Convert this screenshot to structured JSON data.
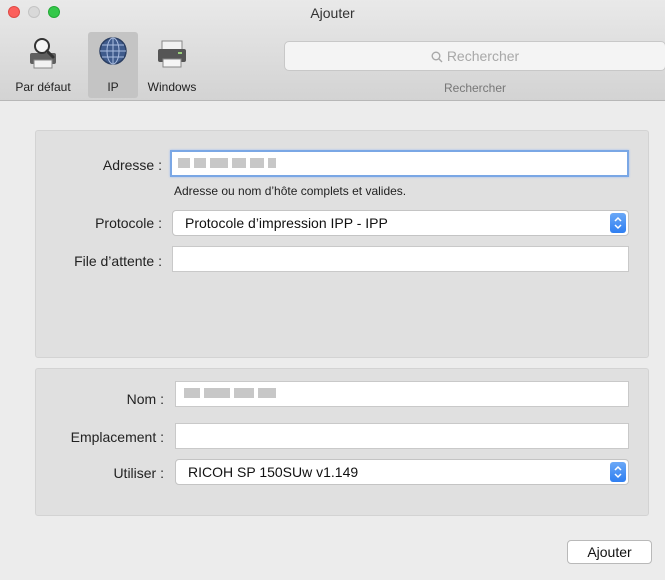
{
  "window": {
    "title": "Ajouter"
  },
  "toolbar": {
    "items": [
      {
        "label": "Par défaut",
        "icon": "default-printer-icon"
      },
      {
        "label": "IP",
        "icon": "globe-icon",
        "selected": true
      },
      {
        "label": "Windows",
        "icon": "windows-printer-icon"
      }
    ]
  },
  "search": {
    "placeholder": "Rechercher",
    "label": "Rechercher"
  },
  "form": {
    "address": {
      "label": "Adresse :",
      "hint": "Adresse ou nom d’hôte complets et valides."
    },
    "protocol": {
      "label": "Protocole :",
      "value": "Protocole d’impression IPP - IPP"
    },
    "queue": {
      "label": "File d’attente :",
      "value": ""
    },
    "name": {
      "label": "Nom :"
    },
    "location": {
      "label": "Emplacement :",
      "value": ""
    },
    "use": {
      "label": "Utiliser :",
      "value": "RICOH SP 150SUw v1.149"
    }
  },
  "buttons": {
    "add": "Ajouter"
  },
  "colors": {
    "accent": "#2f7ff1",
    "close": "#fc605c",
    "zoom": "#34c84a",
    "focus_ring": "#7aa7e5"
  }
}
